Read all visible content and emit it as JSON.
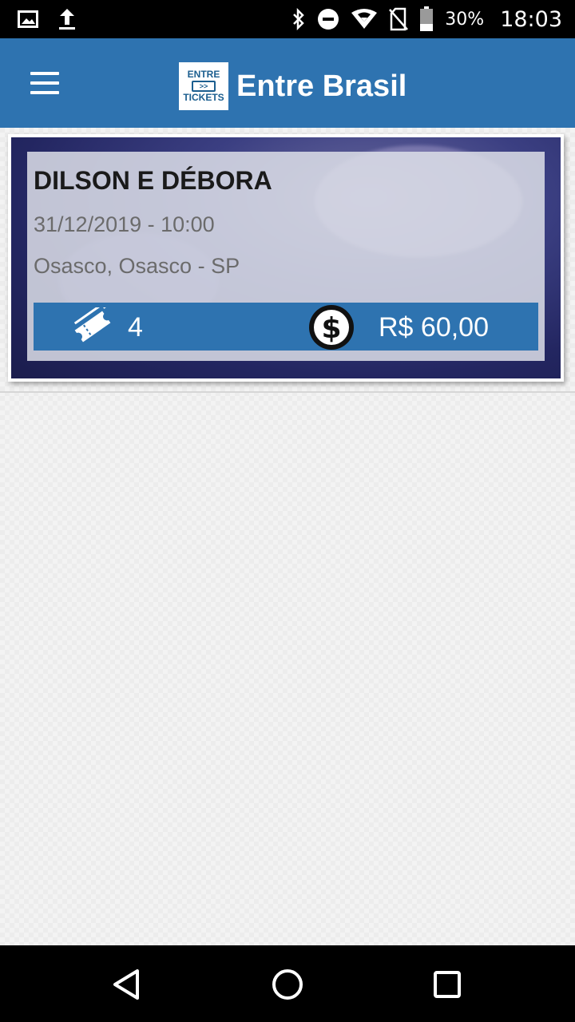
{
  "status_bar": {
    "battery": "30%",
    "time": "18:03",
    "icons": [
      "image-icon",
      "upload-icon",
      "bluetooth-icon",
      "do-not-disturb-icon",
      "wifi-icon",
      "no-sim-icon",
      "battery-icon"
    ]
  },
  "app_bar": {
    "logo_text_top": "ENTRE",
    "logo_text_bottom": "TICKETS",
    "title": "Entre Brasil",
    "menu_icon": "hamburger-menu-icon",
    "brand_color": "#2e73b0"
  },
  "events": [
    {
      "title": "DILSON E DÉBORA",
      "datetime": "31/12/2019 - 10:00",
      "location": "Osasco, Osasco - SP",
      "tickets": "4",
      "price": "R$ 60,00",
      "ticket_icon": "ticket-icon",
      "price_icon": "dollar-coin-icon"
    }
  ],
  "nav_bar": {
    "icons": [
      "back-icon",
      "home-icon",
      "recents-icon"
    ]
  }
}
